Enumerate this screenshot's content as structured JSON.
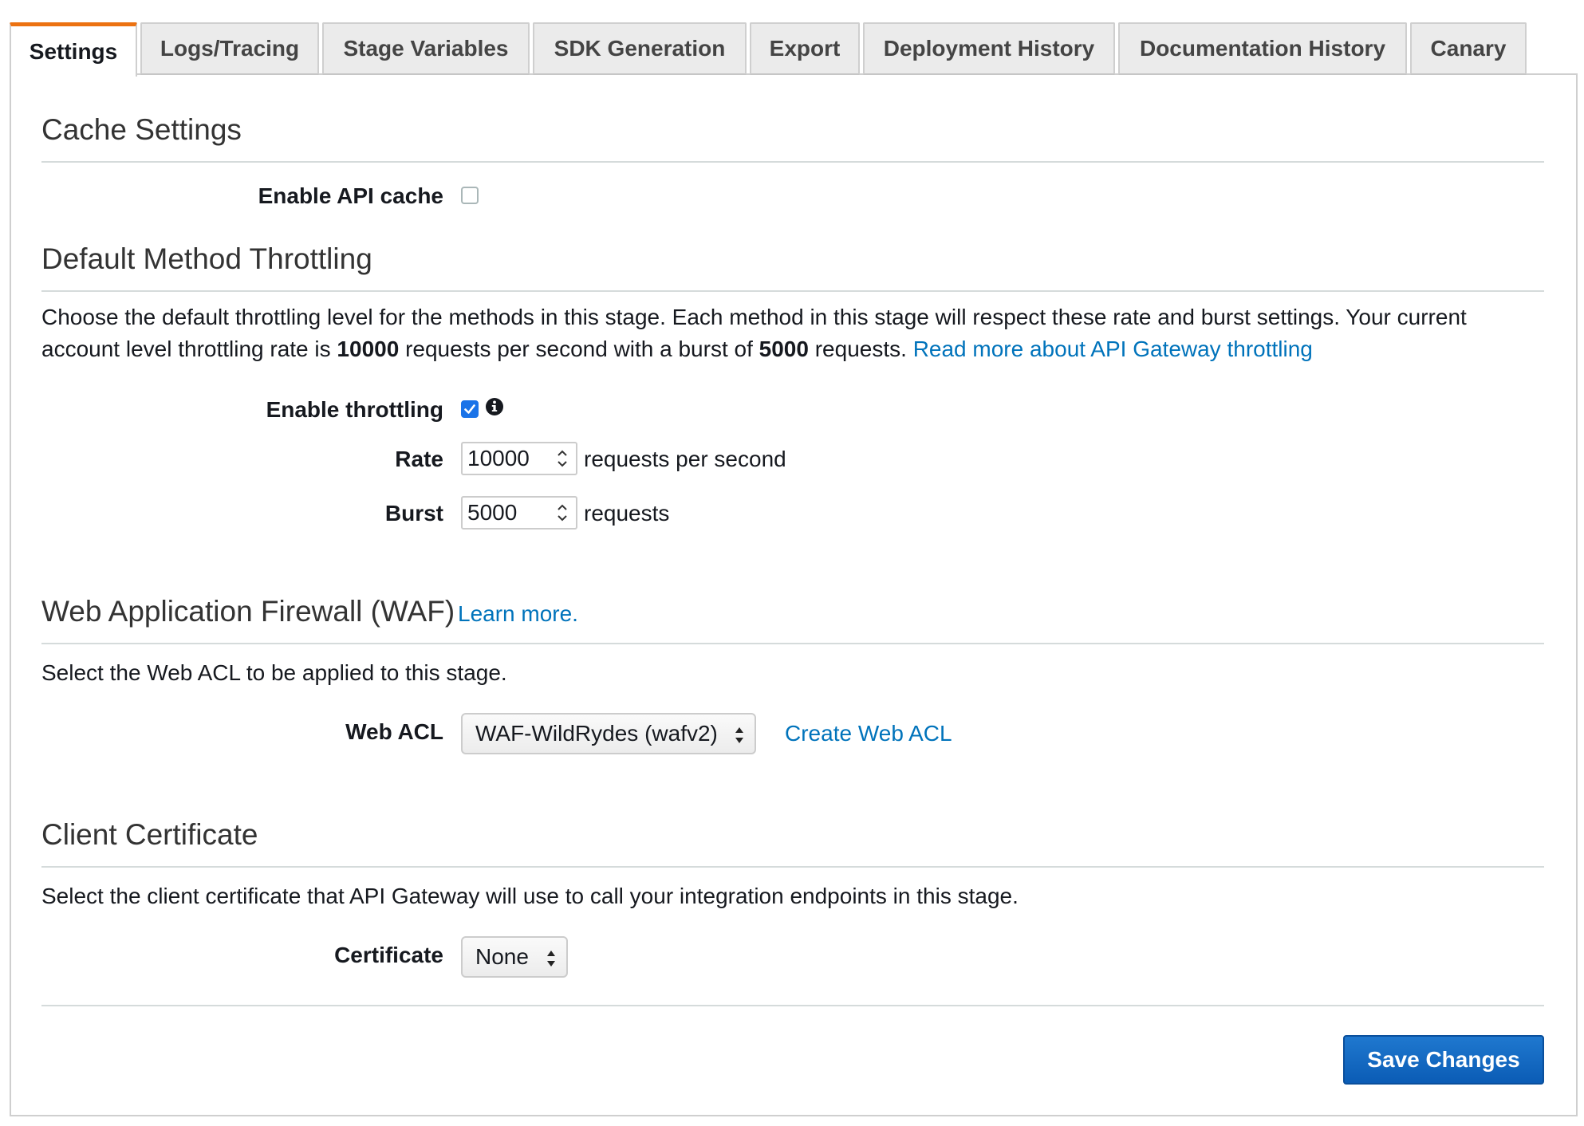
{
  "tabs": [
    {
      "label": "Settings",
      "active": true
    },
    {
      "label": "Logs/Tracing",
      "active": false
    },
    {
      "label": "Stage Variables",
      "active": false
    },
    {
      "label": "SDK Generation",
      "active": false
    },
    {
      "label": "Export",
      "active": false
    },
    {
      "label": "Deployment History",
      "active": false
    },
    {
      "label": "Documentation History",
      "active": false
    },
    {
      "label": "Canary",
      "active": false
    }
  ],
  "cache": {
    "title": "Cache Settings",
    "enable_label": "Enable API cache",
    "enabled": false
  },
  "throttling": {
    "title": "Default Method Throttling",
    "desc_1": "Choose the default throttling level for the methods in this stage. Each method in this stage will respect these rate and burst settings. Your current account level throttling rate is ",
    "account_rate": "10000",
    "desc_2": " requests per second with a burst of ",
    "account_burst": "5000",
    "desc_3": " requests. ",
    "read_more_link": "Read more about API Gateway throttling",
    "enable_label": "Enable throttling",
    "enabled": true,
    "info_icon": "info-icon",
    "rate_label": "Rate",
    "rate_value": "10000",
    "rate_suffix": "requests per second",
    "burst_label": "Burst",
    "burst_value": "5000",
    "burst_suffix": "requests"
  },
  "waf": {
    "title": "Web Application Firewall (WAF)",
    "learn_more": "Learn more.",
    "desc": "Select the Web ACL to be applied to this stage.",
    "acl_label": "Web ACL",
    "acl_selected": "WAF-WildRydes (wafv2)",
    "create_link": "Create Web ACL"
  },
  "certificate": {
    "title": "Client Certificate",
    "desc": "Select the client certificate that API Gateway will use to call your integration endpoints in this stage.",
    "label": "Certificate",
    "selected": "None"
  },
  "actions": {
    "save_label": "Save Changes"
  },
  "colors": {
    "accent_tab": "#ec7211",
    "link": "#0073bb",
    "primary_button": "#0b5cb5",
    "checkbox_checked": "#1a73e8"
  }
}
